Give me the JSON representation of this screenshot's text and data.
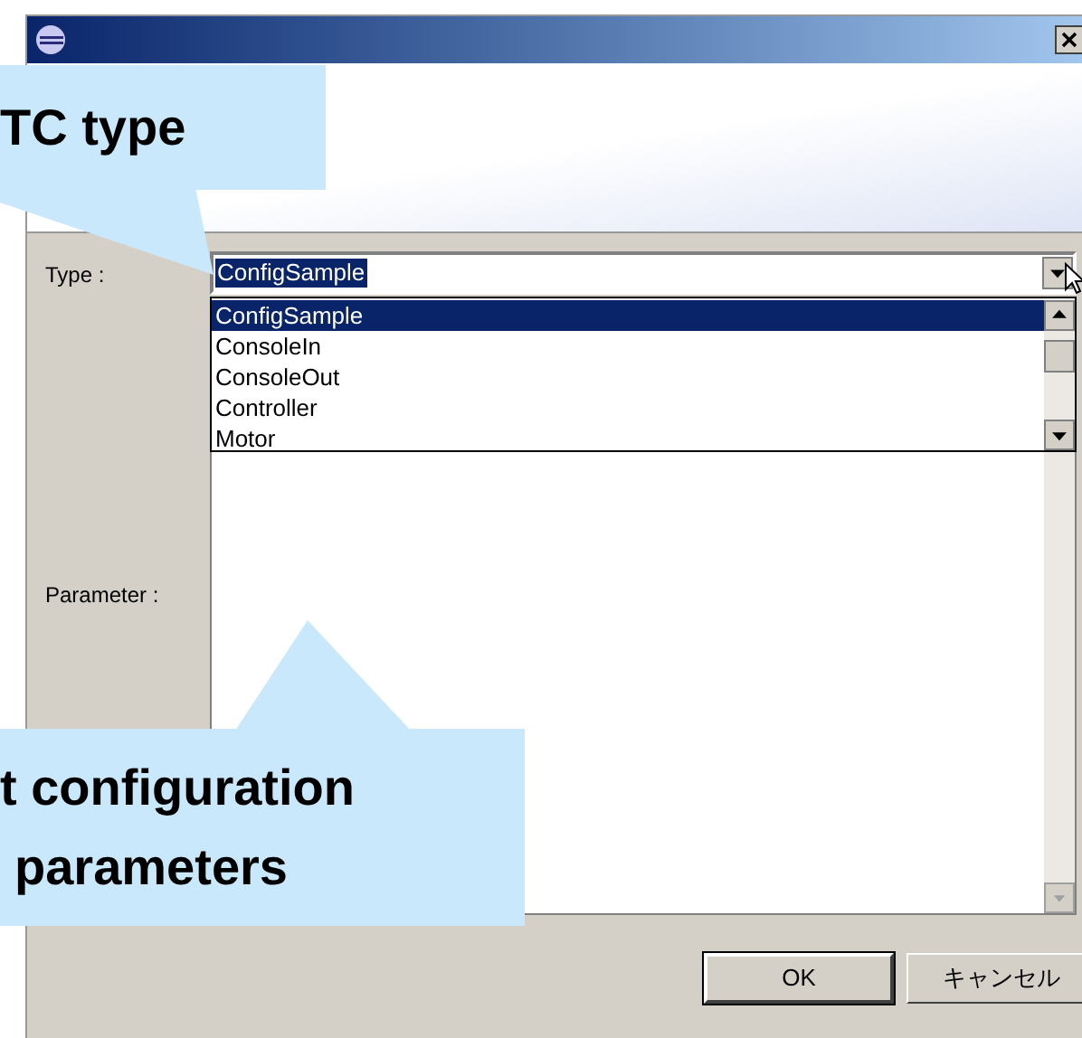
{
  "callouts": [
    {
      "lines": [
        "TC type"
      ]
    },
    {
      "lines": [
        "t configuration",
        "parameters"
      ]
    }
  ],
  "type_field": {
    "label": "Type :",
    "value": "ConfigSample",
    "expanded": true,
    "options": [
      {
        "label": "ConfigSample",
        "selected": true
      },
      {
        "label": "ConsoleIn",
        "selected": false
      },
      {
        "label": "ConsoleOut",
        "selected": false
      },
      {
        "label": "Controller",
        "selected": false
      },
      {
        "label": "Motor",
        "selected": false
      }
    ]
  },
  "parameter_field": {
    "label": "Parameter :"
  },
  "buttons": [
    {
      "label": "OK",
      "default": true
    },
    {
      "label": "キャンセル",
      "default": false
    }
  ]
}
